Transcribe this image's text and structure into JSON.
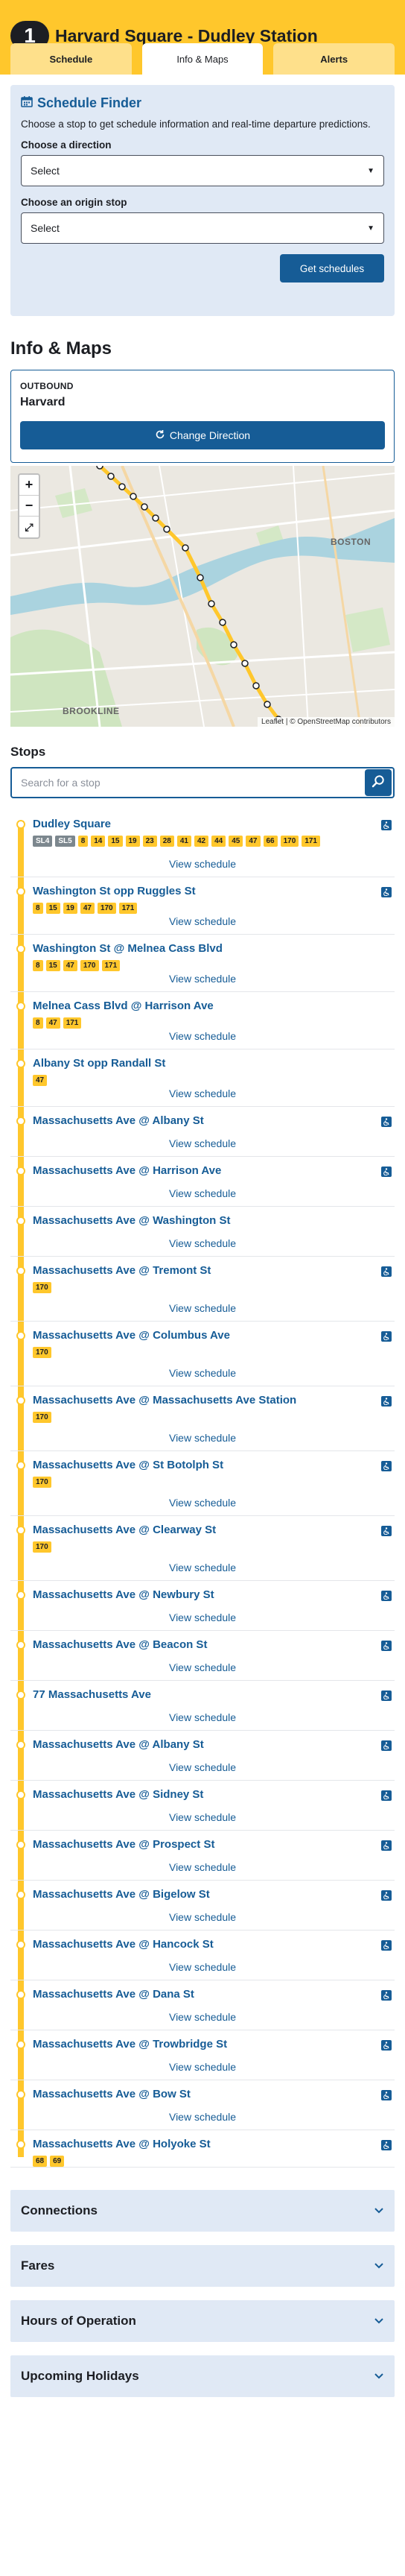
{
  "header": {
    "route_number": "1",
    "title": "Harvard Square - Dudley Station",
    "tabs": [
      {
        "label": "Schedule"
      },
      {
        "label": "Info & Maps"
      },
      {
        "label": "Alerts"
      }
    ]
  },
  "schedule_finder": {
    "title": "Schedule Finder",
    "description": "Choose a stop to get schedule information and real-time departure predictions.",
    "direction_label": "Choose a direction",
    "direction_value": "Select",
    "origin_label": "Choose an origin stop",
    "origin_value": "Select",
    "button": "Get schedules"
  },
  "info_maps": {
    "heading": "Info & Maps",
    "direction_caption": "OUTBOUND",
    "direction_name": "Harvard",
    "change_button": "Change Direction",
    "map_labels": {
      "boston": "BOSTON",
      "brookline": "BROOKLINE"
    },
    "attribution": "Leaflet | © OpenStreetMap contributors"
  },
  "stops": {
    "heading": "Stops",
    "search_placeholder": "Search for a stop",
    "view_schedule": "View schedule",
    "items": [
      {
        "name": "Dudley Square",
        "accessible": true,
        "connections": [
          "SL4",
          "SL5",
          "8",
          "14",
          "15",
          "19",
          "23",
          "28",
          "41",
          "42",
          "44",
          "45",
          "47",
          "66",
          "170",
          "171"
        ]
      },
      {
        "name": "Washington St opp Ruggles St",
        "accessible": true,
        "connections": [
          "8",
          "15",
          "19",
          "47",
          "170",
          "171"
        ]
      },
      {
        "name": "Washington St @ Melnea Cass Blvd",
        "accessible": false,
        "connections": [
          "8",
          "15",
          "47",
          "170",
          "171"
        ]
      },
      {
        "name": "Melnea Cass Blvd @ Harrison Ave",
        "accessible": false,
        "connections": [
          "8",
          "47",
          "171"
        ]
      },
      {
        "name": "Albany St opp Randall St",
        "accessible": false,
        "connections": [
          "47"
        ]
      },
      {
        "name": "Massachusetts Ave @ Albany St",
        "accessible": true,
        "connections": []
      },
      {
        "name": "Massachusetts Ave @ Harrison Ave",
        "accessible": true,
        "connections": []
      },
      {
        "name": "Massachusetts Ave @ Washington St",
        "accessible": false,
        "connections": []
      },
      {
        "name": "Massachusetts Ave @ Tremont St",
        "accessible": true,
        "connections": [
          "170"
        ]
      },
      {
        "name": "Massachusetts Ave @ Columbus Ave",
        "accessible": true,
        "connections": [
          "170"
        ]
      },
      {
        "name": "Massachusetts Ave @ Massachusetts Ave Station",
        "accessible": true,
        "connections": [
          "170"
        ]
      },
      {
        "name": "Massachusetts Ave @ St Botolph St",
        "accessible": true,
        "connections": [
          "170"
        ]
      },
      {
        "name": "Massachusetts Ave @ Clearway St",
        "accessible": true,
        "connections": [
          "170"
        ]
      },
      {
        "name": "Massachusetts Ave @ Newbury St",
        "accessible": true,
        "connections": []
      },
      {
        "name": "Massachusetts Ave @ Beacon St",
        "accessible": true,
        "connections": []
      },
      {
        "name": "77 Massachusetts Ave",
        "accessible": true,
        "connections": []
      },
      {
        "name": "Massachusetts Ave @ Albany St",
        "accessible": true,
        "connections": []
      },
      {
        "name": "Massachusetts Ave @ Sidney St",
        "accessible": true,
        "connections": []
      },
      {
        "name": "Massachusetts Ave @ Prospect St",
        "accessible": true,
        "connections": []
      },
      {
        "name": "Massachusetts Ave @ Bigelow St",
        "accessible": true,
        "connections": []
      },
      {
        "name": "Massachusetts Ave @ Hancock St",
        "accessible": true,
        "connections": []
      },
      {
        "name": "Massachusetts Ave @ Dana St",
        "accessible": true,
        "connections": []
      },
      {
        "name": "Massachusetts Ave @ Trowbridge St",
        "accessible": true,
        "connections": []
      },
      {
        "name": "Massachusetts Ave @ Bow St",
        "accessible": true,
        "connections": []
      },
      {
        "name": "Massachusetts Ave @ Holyoke St",
        "accessible": true,
        "connections": [
          "68",
          "69"
        ]
      }
    ]
  },
  "accordions": [
    {
      "label": "Connections"
    },
    {
      "label": "Fares"
    },
    {
      "label": "Hours of Operation"
    },
    {
      "label": "Upcoming Holidays"
    }
  ],
  "colors": {
    "bus_yellow": "#ffc72c",
    "link_blue": "#165c96",
    "silver_line": "#7c878e",
    "panel_blue": "#e0e9f5"
  }
}
